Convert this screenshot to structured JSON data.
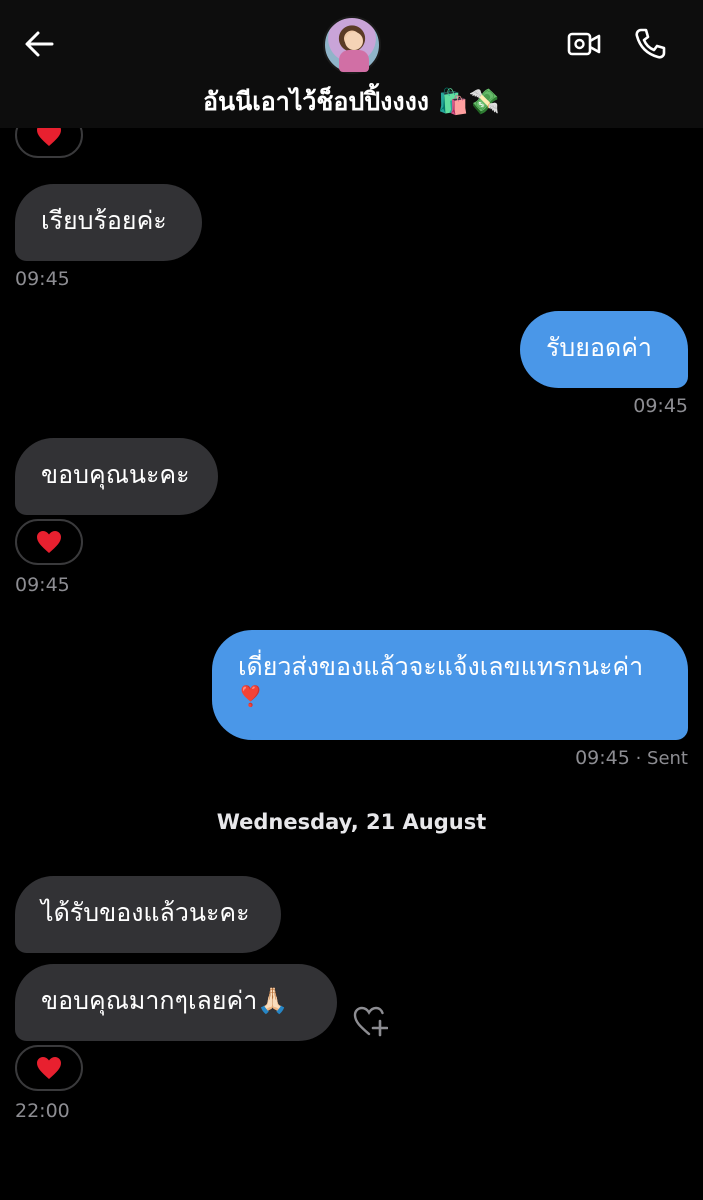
{
  "header": {
    "title": "อันนีเอาไว้ช็อปปิ้งงงง 🛍️💸",
    "back_icon": "arrow-left-icon",
    "video_icon": "video-camera-icon",
    "call_icon": "phone-icon"
  },
  "messages": [
    {
      "id": "m1",
      "direction": "incoming",
      "text": "เรียบร้อยค่ะ",
      "time": "09:45"
    },
    {
      "id": "m2",
      "direction": "outgoing",
      "text": "รับยอดค่า",
      "time": "09:45"
    },
    {
      "id": "m3",
      "direction": "incoming",
      "text": "ขอบคุณนะคะ",
      "time": "09:45",
      "reaction": "❤️"
    },
    {
      "id": "m4",
      "direction": "outgoing",
      "text_line1": "เดี่ยวส่งของแล้วจะแจ้งเลขแทรกนะค่า",
      "text_line2": "❣️",
      "time": "09:45",
      "status": " · Sent"
    },
    {
      "id": "m5",
      "direction": "incoming",
      "text": "ได้รับของแล้วนะคะ"
    },
    {
      "id": "m6",
      "direction": "incoming",
      "text": "ขอบคุณมากๆเลยค่า🙏🏻",
      "time": "22:00",
      "reaction": "❤️"
    }
  ],
  "date_separator": "Wednesday, 21 August",
  "colors": {
    "incoming_bubble": "#323235",
    "outgoing_bubble": "#4a97e8",
    "heart": "#e8202f",
    "timestamp": "#8d8d92"
  }
}
